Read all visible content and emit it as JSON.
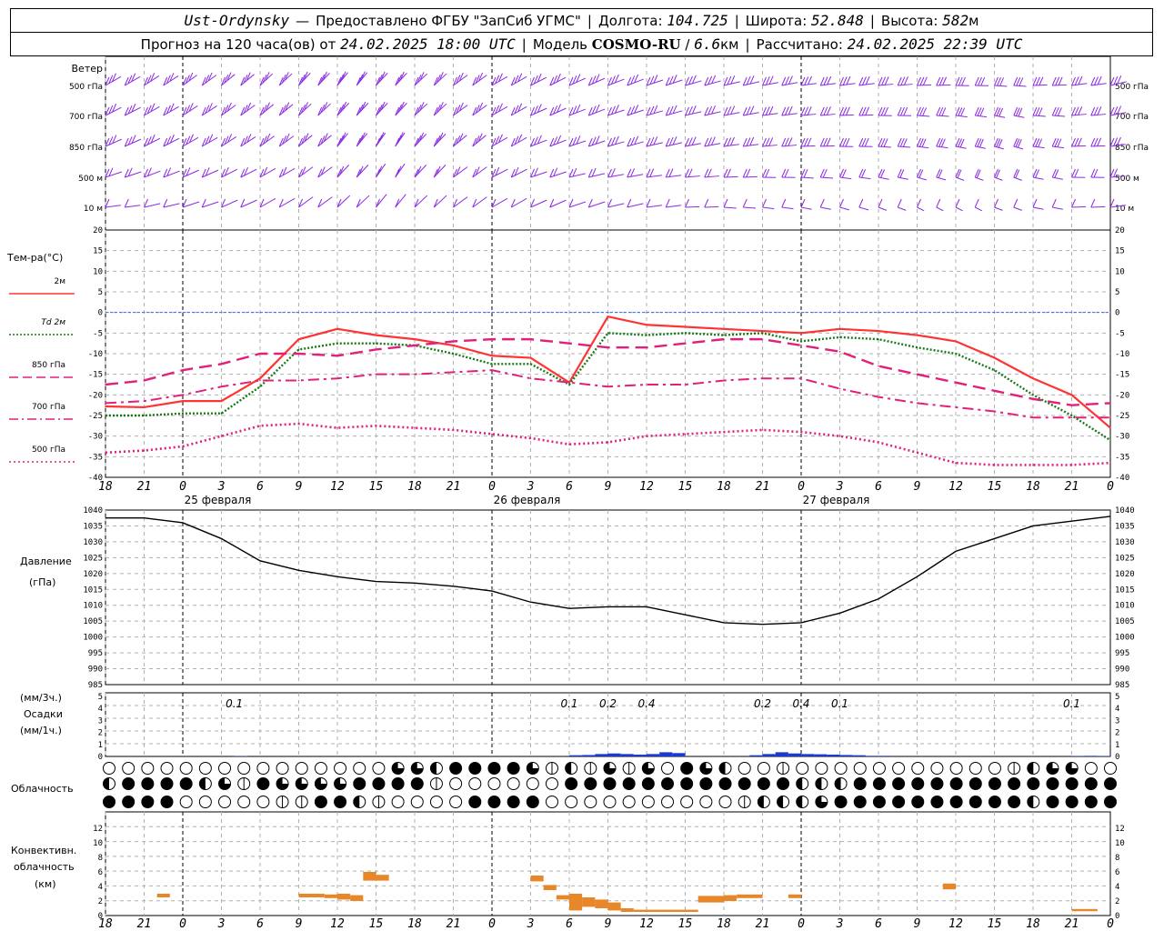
{
  "header": {
    "station": "Ust-Ordynsky",
    "provider_prefix": "Предоставлено ФГБУ",
    "provider": "\"ЗапСиб УГМС\"",
    "lon_label": "Долгота:",
    "lon": "104.725",
    "lat_label": "Широта:",
    "lat": "52.848",
    "alt_label": "Высота:",
    "alt": "582",
    "alt_unit": "м",
    "forecast_prefix": "Прогноз на 120 часа(ов)",
    "from_label": "от",
    "issued": "24.02.2025 18:00 UTC",
    "model_label": "Модель",
    "model": "COSMO-RU",
    "model_res": "6.6",
    "model_res_unit": "км",
    "computed_label": "Рассчитано:",
    "computed": "24.02.2025 22:39 UTC"
  },
  "wind_panel": {
    "labels": [
      "Ветер",
      "500 гПа",
      "700 гПа",
      "850 гПа",
      "500 м",
      "10 м"
    ],
    "right_labels": [
      "500 гПа",
      "700 гПа",
      "850 гПа",
      "500 м",
      "10 м"
    ],
    "color": "#8a2be2"
  },
  "temp_panel": {
    "title": "Тем-ра(°C)",
    "legend": [
      {
        "label": "2м",
        "color": "#ff3333",
        "style": "solid"
      },
      {
        "label": "Td 2м",
        "color": "#1a7a1a",
        "style": "dotted"
      },
      {
        "label": "850 гПа",
        "color": "#e0207a",
        "style": "dash"
      },
      {
        "label": "700 гПа",
        "color": "#e0207a",
        "style": "dashdot"
      },
      {
        "label": "500 гПа",
        "color": "#e0207a",
        "style": "dot"
      }
    ],
    "y_ticks": [
      "20",
      "15",
      "10",
      "5",
      "0",
      "-5",
      "-10",
      "-15",
      "-20",
      "-25",
      "-30",
      "-35",
      "-40"
    ]
  },
  "time_axis": {
    "ticks": [
      "18",
      "21",
      "0",
      "3",
      "6",
      "9",
      "12",
      "15",
      "18",
      "21",
      "0",
      "3",
      "6",
      "9",
      "12",
      "15",
      "18",
      "21",
      "0",
      "3",
      "6",
      "9",
      "12",
      "15",
      "18",
      "21",
      "0"
    ],
    "days": [
      "25 февраля",
      "26 февраля",
      "27 февраля"
    ]
  },
  "pressure_panel": {
    "title": "Давление",
    "unit": "(гПа)",
    "y_ticks": [
      "1040",
      "1035",
      "1030",
      "1025",
      "1020",
      "1015",
      "1010",
      "1005",
      "1000",
      "995",
      "990",
      "985"
    ]
  },
  "precip_panel": {
    "label_3h": "(мм/3ч.)",
    "title": "Осадки",
    "label_1h": "(мм/1ч.)",
    "y_ticks": [
      "5",
      "4",
      "3",
      "2",
      "1",
      "0"
    ],
    "annotations": [
      {
        "hour": 10,
        "text": "0.1"
      },
      {
        "hour": 36,
        "text": "0.1"
      },
      {
        "hour": 39,
        "text": "0.2"
      },
      {
        "hour": 42,
        "text": "0.4"
      },
      {
        "hour": 51,
        "text": "0.2"
      },
      {
        "hour": 54,
        "text": "0.4"
      },
      {
        "hour": 57,
        "text": "0.1"
      },
      {
        "hour": 75,
        "text": "0.1"
      }
    ]
  },
  "cloud_panel": {
    "title": "Облачность"
  },
  "conv_panel": {
    "title_1": "Конвективн.",
    "title_2": "облачность",
    "unit": "(км)",
    "y_ticks": [
      "12",
      "10",
      "8",
      "6",
      "4",
      "2",
      "0"
    ],
    "color": "#e8862a"
  },
  "chart_data": [
    {
      "type": "line",
      "title": "Тем-ра(°C)",
      "x_hours_from_issue": [
        0,
        3,
        6,
        9,
        12,
        15,
        18,
        21,
        24,
        27,
        30,
        33,
        36,
        39,
        42,
        45,
        48,
        51,
        54,
        57,
        60,
        63,
        66,
        69,
        72,
        75,
        78
      ],
      "ylim": [
        -40,
        20
      ],
      "series": [
        {
          "name": "2м",
          "values": [
            -22.8,
            -23,
            -21.5,
            -21.5,
            -16,
            -6.5,
            -4,
            -5.5,
            -6.5,
            -8,
            -10.5,
            -11,
            -17,
            -1,
            -3,
            -3.5,
            -4,
            -4.5,
            -5,
            -4,
            -4.5,
            -5.5,
            -7,
            -11,
            -16,
            -20,
            -28
          ]
        },
        {
          "name": "Td 2м",
          "values": [
            -25,
            -25,
            -24.5,
            -24.5,
            -18,
            -9,
            -7.5,
            -7.5,
            -8,
            -10,
            -12.5,
            -12.5,
            -17.5,
            -5,
            -5.5,
            -5,
            -5.5,
            -5,
            -7,
            -6,
            -6.5,
            -8.5,
            -10,
            -14,
            -20,
            -25,
            -31
          ]
        },
        {
          "name": "850 гПа",
          "values": [
            -17.5,
            -16.5,
            -14,
            -12.5,
            -10,
            -10,
            -10.5,
            -9,
            -8,
            -7,
            -6.5,
            -6.5,
            -7.5,
            -8.5,
            -8.5,
            -7.5,
            -6.5,
            -6.5,
            -8,
            -9.5,
            -13,
            -15,
            -17,
            -19,
            -21,
            -22.5,
            -22
          ]
        },
        {
          "name": "700 гПа",
          "values": [
            -22,
            -21.5,
            -20,
            -18,
            -16.5,
            -16.5,
            -16,
            -15,
            -15,
            -14.5,
            -14,
            -16,
            -17,
            -18,
            -17.5,
            -17.5,
            -16.5,
            -16,
            -16,
            -18.5,
            -20.5,
            -22,
            -23,
            -24,
            -25.5,
            -25.5,
            -25.5
          ]
        },
        {
          "name": "500 гПа",
          "values": [
            -34,
            -33.5,
            -32.5,
            -30,
            -27.5,
            -27,
            -28,
            -27.5,
            -28,
            -28.5,
            -29.5,
            -30.5,
            -32,
            -31.5,
            -30,
            -29.5,
            -29,
            -28.5,
            -29,
            -30,
            -31.5,
            -34,
            -36.5,
            -37,
            -37,
            -37,
            -36.5
          ]
        }
      ]
    },
    {
      "type": "line",
      "title": "Давление",
      "ylabel": "(гПа)",
      "x_hours_from_issue": [
        0,
        3,
        6,
        9,
        12,
        15,
        18,
        21,
        24,
        27,
        30,
        33,
        36,
        39,
        42,
        45,
        48,
        51,
        54,
        57,
        60,
        63,
        66,
        69,
        72,
        75,
        78
      ],
      "ylim": [
        985,
        1040
      ],
      "series": [
        {
          "name": "Давление",
          "values": [
            1037.5,
            1037.5,
            1036,
            1031,
            1024,
            1021,
            1019,
            1017.5,
            1017,
            1016,
            1014.5,
            1011,
            1009,
            1009.5,
            1009.5,
            1007,
            1004.5,
            1004,
            1004.5,
            1007.5,
            1012,
            1019,
            1027,
            1031,
            1035,
            1036.5,
            1038
          ]
        }
      ]
    },
    {
      "type": "bar",
      "title": "Осадки",
      "ylabel": "(мм/3ч.)",
      "ylim": [
        0,
        5
      ],
      "x_hours_from_issue": [
        10,
        36,
        37,
        38,
        39,
        40,
        41,
        42,
        43,
        44,
        50,
        51,
        52,
        53,
        54,
        55,
        56,
        57,
        58,
        59,
        60,
        75,
        76,
        77
      ],
      "values": [
        0.03,
        0.1,
        0.12,
        0.2,
        0.25,
        0.2,
        0.15,
        0.2,
        0.35,
        0.28,
        0.1,
        0.2,
        0.35,
        0.25,
        0.2,
        0.18,
        0.15,
        0.12,
        0.1,
        0.05,
        0.05,
        0.03,
        0.05,
        0.03
      ]
    },
    {
      "type": "table",
      "title": "Облачность",
      "cover_codes": "0=clear,1=quarter,2=half,3=three-quarters,4=overcast",
      "rows": [
        {
          "name": "upper",
          "values": "0000000000000003324444312131304320010000000000012330000000000000000000000000000"
        },
        {
          "name": "middle",
          "values": "2444423143333444410000004444444444442224444444444444444440000000000000000000000"
        },
        {
          "name": "lower",
          "values": "4444000001144210000444400000000001222344444444442444400034300000000000000000244444"
        }
      ]
    },
    {
      "type": "bar",
      "title": "Конвективн. облачность",
      "ylabel": "(км)",
      "ylim": [
        0,
        13
      ],
      "segments": [
        {
          "hour_start": 4,
          "hour_end": 5,
          "base_km": 2.5,
          "top_km": 3
        },
        {
          "hour_start": 15,
          "hour_end": 17,
          "base_km": 2.5,
          "top_km": 3
        },
        {
          "hour_start": 17,
          "hour_end": 18,
          "base_km": 2.4,
          "top_km": 2.9
        },
        {
          "hour_start": 18,
          "hour_end": 19,
          "base_km": 2.2,
          "top_km": 3
        },
        {
          "hour_start": 19,
          "hour_end": 20,
          "base_km": 2,
          "top_km": 2.8
        },
        {
          "hour_start": 20,
          "hour_end": 21,
          "base_km": 4.8,
          "top_km": 6
        },
        {
          "hour_start": 21,
          "hour_end": 22,
          "base_km": 4.8,
          "top_km": 5.6
        },
        {
          "hour_start": 33,
          "hour_end": 34,
          "base_km": 4.7,
          "top_km": 5.5
        },
        {
          "hour_start": 34,
          "hour_end": 35,
          "base_km": 3.5,
          "top_km": 4.2
        },
        {
          "hour_start": 35,
          "hour_end": 36,
          "base_km": 2.2,
          "top_km": 2.8
        },
        {
          "hour_start": 36,
          "hour_end": 37,
          "base_km": 0.7,
          "top_km": 3
        },
        {
          "hour_start": 37,
          "hour_end": 38,
          "base_km": 1.2,
          "top_km": 2.5
        },
        {
          "hour_start": 38,
          "hour_end": 39,
          "base_km": 1,
          "top_km": 2.2
        },
        {
          "hour_start": 39,
          "hour_end": 40,
          "base_km": 0.7,
          "top_km": 1.8
        },
        {
          "hour_start": 40,
          "hour_end": 41,
          "base_km": 0.5,
          "top_km": 1
        },
        {
          "hour_start": 41,
          "hour_end": 46,
          "base_km": 0.5,
          "top_km": 0.8
        },
        {
          "hour_start": 46,
          "hour_end": 48,
          "base_km": 1.8,
          "top_km": 2.7
        },
        {
          "hour_start": 48,
          "hour_end": 49,
          "base_km": 2,
          "top_km": 2.8
        },
        {
          "hour_start": 49,
          "hour_end": 51,
          "base_km": 2.4,
          "top_km": 2.9
        },
        {
          "hour_start": 53,
          "hour_end": 54,
          "base_km": 2.4,
          "top_km": 2.9
        },
        {
          "hour_start": 65,
          "hour_end": 66,
          "base_km": 3.6,
          "top_km": 4.4
        },
        {
          "hour_start": 75,
          "hour_end": 77,
          "base_km": 0.6,
          "top_km": 0.9
        }
      ]
    }
  ]
}
